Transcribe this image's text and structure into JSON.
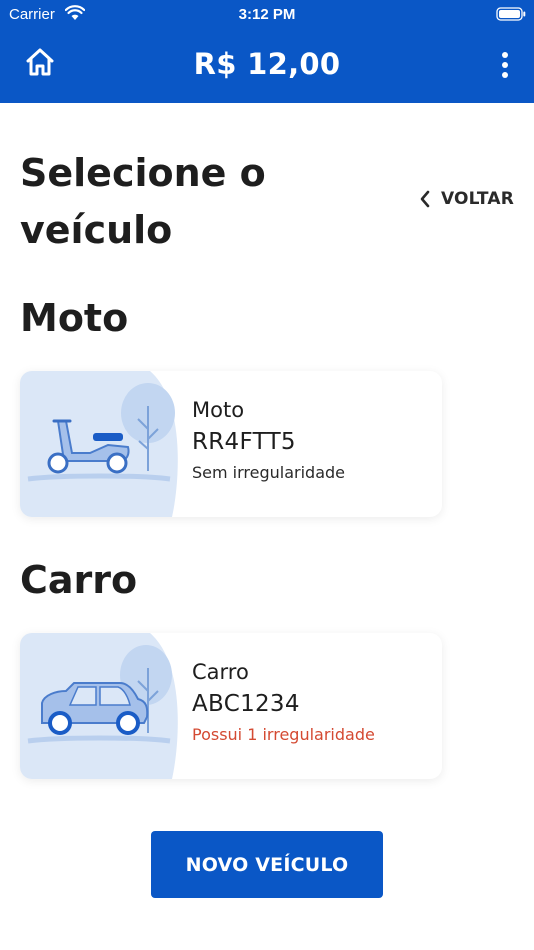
{
  "status_bar": {
    "carrier": "Carrier",
    "time": "3:12 PM"
  },
  "header": {
    "balance": "R$ 12,00",
    "home_icon": "home-icon",
    "menu_icon": "more-vertical-icon",
    "color": "#0a57c6"
  },
  "page": {
    "title": "Selecione o veículo",
    "back_label": "VOLTAR"
  },
  "sections": [
    {
      "title": "Moto",
      "vehicle": {
        "type": "Moto",
        "plate": "RR4FTT5",
        "status": "Sem irregularidade",
        "status_color": "#2a2a2a",
        "icon": "scooter-icon"
      }
    },
    {
      "title": "Carro",
      "vehicle": {
        "type": "Carro",
        "plate": "ABC1234",
        "status": "Possui 1 irregularidade",
        "status_color": "#d44a32",
        "icon": "car-icon"
      }
    }
  ],
  "actions": {
    "new_vehicle": "NOVO VEÍCULO"
  }
}
